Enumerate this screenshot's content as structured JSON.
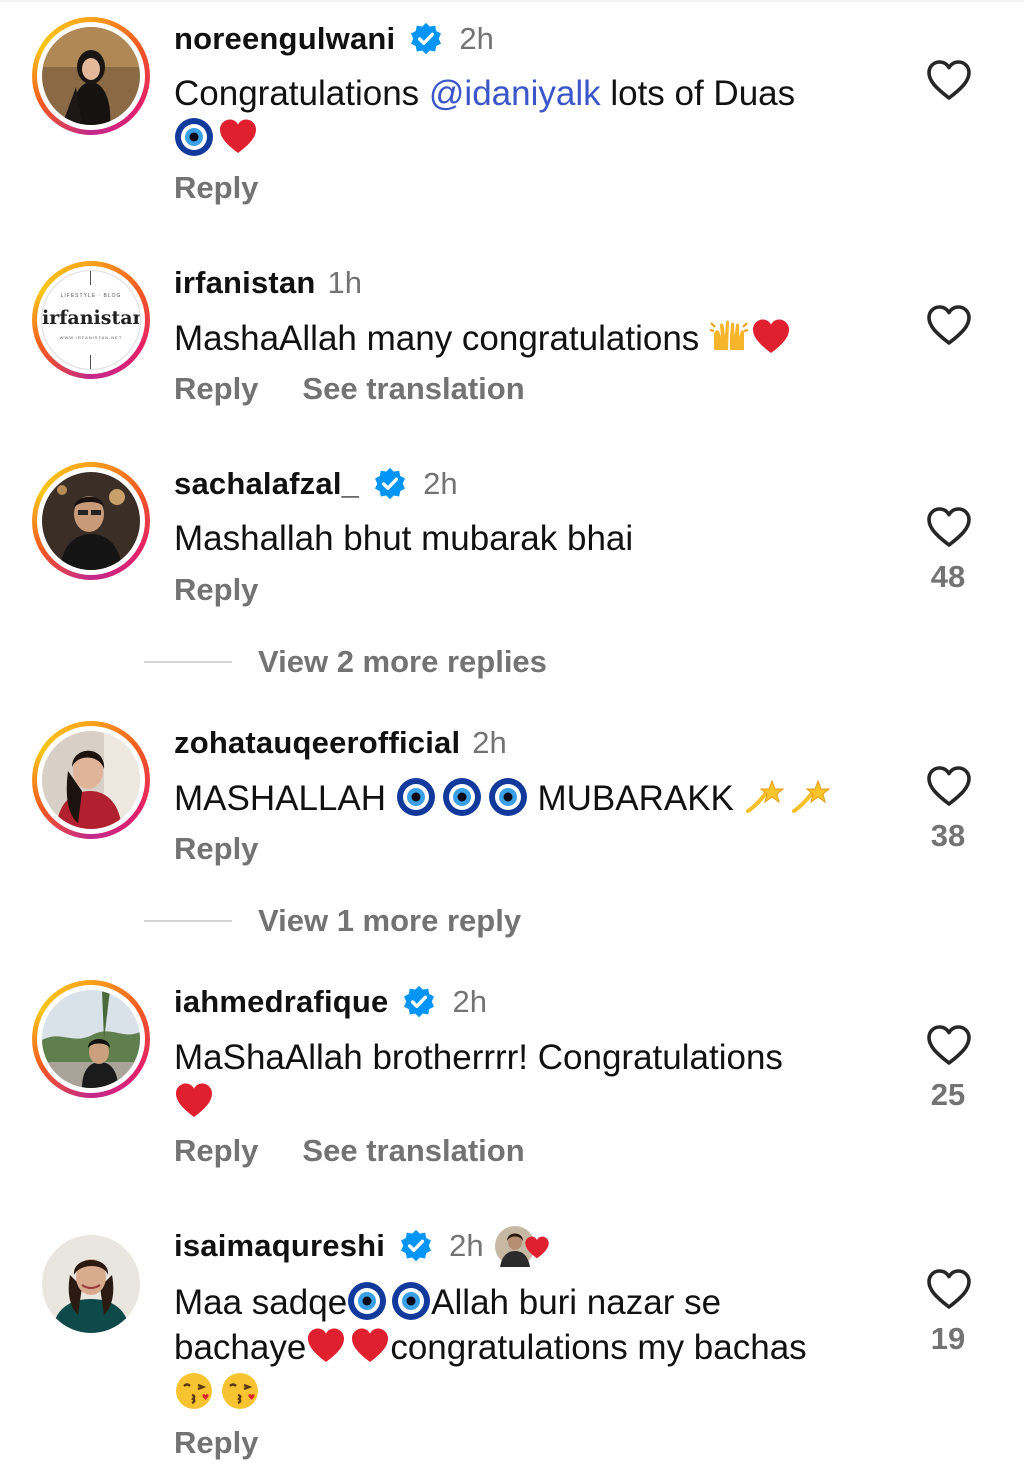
{
  "comments": [
    {
      "username": "noreengulwani",
      "time": "2h",
      "verified": true,
      "text_before": "Congratulations ",
      "mention": "@idaniyalk",
      "text_after": " lots of Duas",
      "emojis": [
        "nazar-amulet",
        "red-heart"
      ],
      "reply": "Reply",
      "likes": ""
    },
    {
      "username": "irfanistan",
      "time": "1h",
      "verified": false,
      "text": "MashaAllah many congratulations ",
      "emojis": [
        "raising-hands",
        "red-heart"
      ],
      "reply": "Reply",
      "translation": "See translation",
      "likes": "",
      "logo_text": "irfanistan",
      "logo_top": "LIFESTYLE · BLOG",
      "logo_bottom": "WWW.IRFANISTAN.NET"
    },
    {
      "username": "sachalafzal_",
      "time": "2h",
      "verified": true,
      "text": "Mashallah bhut mubarak bhai",
      "reply": "Reply",
      "likes": "48"
    },
    {
      "username": "zohatauqeerofficial",
      "time": "2h",
      "verified": false,
      "text_before": "MASHALLAH ",
      "text_after": " MUBARAKK ",
      "emojis": [
        "nazar-amulet",
        "nazar-amulet",
        "nazar-amulet",
        "dizzy",
        "dizzy"
      ],
      "reply": "Reply",
      "likes": "38"
    },
    {
      "username": "iahmedrafique",
      "time": "2h",
      "verified": true,
      "text": "MaShaAllah brotherrrr! Congratulations",
      "emojis": [
        "red-heart"
      ],
      "reply": "Reply",
      "translation": "See translation",
      "likes": "25"
    },
    {
      "username": "isaimaqureshi",
      "time": "2h",
      "verified": true,
      "text_1": "Maa sadqe",
      "text_2": "Allah buri nazar se",
      "text_3": "bachaye",
      "text_4": "congratulations my bachas",
      "reply": "Reply",
      "likes": "19"
    }
  ],
  "view_more": [
    "View 2 more replies",
    "View 1 more reply"
  ],
  "colors": {
    "accent": "#0095f6",
    "mention": "#3a56c8",
    "muted": "#737373",
    "heart_emoji": "#e0202f"
  }
}
